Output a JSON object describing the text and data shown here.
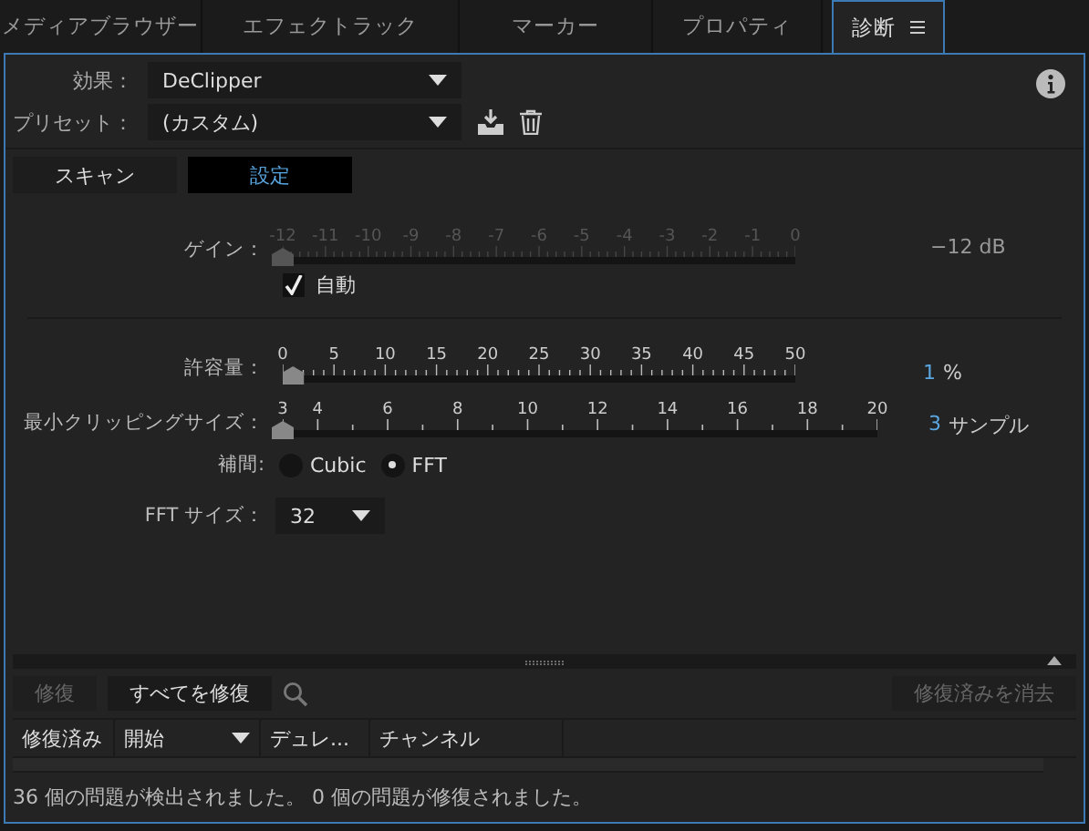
{
  "tabs": [
    {
      "label": "メディアブラウザー",
      "selected": false
    },
    {
      "label": "エフェクトラック",
      "selected": false
    },
    {
      "label": "マーカー",
      "selected": false
    },
    {
      "label": "プロパティ",
      "selected": false
    },
    {
      "label": "診断",
      "selected": true
    }
  ],
  "effect": {
    "label": "効果：",
    "value": "DeClipper"
  },
  "preset": {
    "label": "プリセット：",
    "value": "(カスタム)"
  },
  "subtabs": [
    {
      "label": "スキャン",
      "selected": false
    },
    {
      "label": "設定",
      "selected": true
    }
  ],
  "gain": {
    "label": "ゲイン：",
    "ticks": [
      "-12",
      "-11",
      "-10",
      "-9",
      "-8",
      "-7",
      "-6",
      "-5",
      "-4",
      "-3",
      "-2",
      "-1",
      "0"
    ],
    "level": 0,
    "reading": "−12 dB",
    "disabled": true,
    "auto": {
      "label": "自動",
      "checked": true
    }
  },
  "sliders": [
    {
      "label": "許容量：",
      "ticks": [
        "0",
        "5",
        "10",
        "15",
        "20",
        "25",
        "30",
        "35",
        "40",
        "45",
        "50"
      ],
      "level": 0.02,
      "value": "1",
      "unit": "%"
    },
    {
      "label": "最小クリッピングサイズ：",
      "ticks": [
        "3",
        "4",
        "6",
        "8",
        "10",
        "12",
        "14",
        "16",
        "18",
        "20"
      ],
      "level": 0,
      "value": "3",
      "unit": "サンプル"
    }
  ],
  "interpolation": {
    "label": "補間:",
    "options": [
      {
        "label": "Cubic",
        "selected": false
      },
      {
        "label": "FFT",
        "selected": true
      }
    ]
  },
  "fft_size": {
    "label": "FFT サイズ：",
    "value": "32"
  },
  "buttons": {
    "repair": {
      "label": "修復",
      "disabled": true
    },
    "repair_all": {
      "label": "すべてを修復",
      "disabled": false
    },
    "clear": {
      "label": "修復済みを消去",
      "disabled": true
    }
  },
  "table": {
    "columns": [
      "修復済み",
      "開始",
      "デュレ...",
      "チャンネル"
    ]
  },
  "status_bar": "36 個の問題が検出されました。 0 個の問題が修復されました。"
}
